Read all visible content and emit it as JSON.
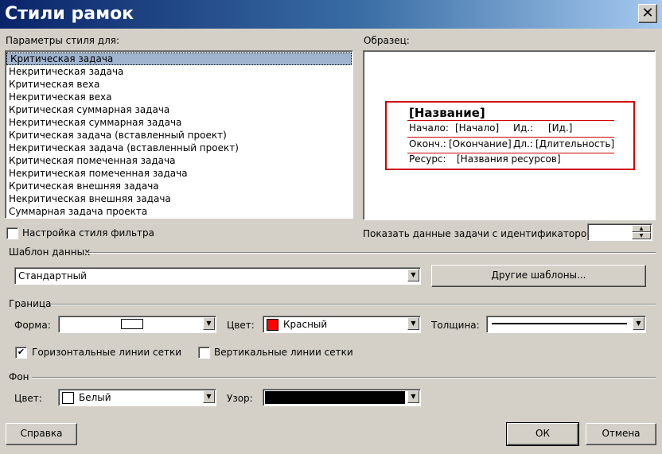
{
  "window": {
    "title": "Стили рамок",
    "close_label": "✕"
  },
  "params": {
    "label": "Параметры стиля для:",
    "items": [
      "Критическая задача",
      "Некритическая задача",
      "Критическая веха",
      "Некритическая веха",
      "Критическая суммарная задача",
      "Некритическая суммарная задача",
      "Критическая задача (вставленный проект)",
      "Некритическая задача (вставленный проект)",
      "Критическая помеченная задача",
      "Некритическая помеченная задача",
      "Критическая внешняя задача",
      "Некритическая внешняя задача",
      "Суммарная задача проекта"
    ],
    "selected_index": 0
  },
  "sample": {
    "label": "Образец:",
    "title": "[Название]",
    "rows": [
      {
        "k1": "Начало:",
        "v1": "[Начало]",
        "k2": "Ид.:",
        "v2": "[Ид.]"
      },
      {
        "k1": "Оконч.:",
        "v1": "[Окончание]",
        "k2": "Дл.:",
        "v2": "[Длительность]"
      },
      {
        "k1": "Ресурс:",
        "v1": "[Названия ресурсов]",
        "k2": "",
        "v2": ""
      }
    ],
    "border_color": "#d00000"
  },
  "filter_style": {
    "label": "Настройка стиля фильтра",
    "checked": false
  },
  "show_task": {
    "label": "Показать данные задачи с идентификатором:",
    "value": ""
  },
  "template": {
    "group_label": "Шаблон данных",
    "value": "Стандартный",
    "other_button": "Другие шаблоны..."
  },
  "border": {
    "group_label": "Граница",
    "shape_label": "Форма:",
    "color_label": "Цвет:",
    "color_value": "Красный",
    "color_swatch": "#ff0000",
    "width_label": "Толщина:",
    "hgrid_label": "Горизонтальные линии сетки",
    "hgrid_checked": true,
    "vgrid_label": "Вертикальные линии сетки",
    "vgrid_checked": false
  },
  "background": {
    "group_label": "Фон",
    "color_label": "Цвет:",
    "color_value": "Белый",
    "color_swatch": "#ffffff",
    "pattern_label": "Узор:",
    "pattern_color": "#000000"
  },
  "buttons": {
    "help": "Справка",
    "ok": "ОК",
    "cancel": "Отмена"
  },
  "icons": {
    "check": "✔",
    "arrow_down": "▼",
    "arrow_up": "▲"
  }
}
